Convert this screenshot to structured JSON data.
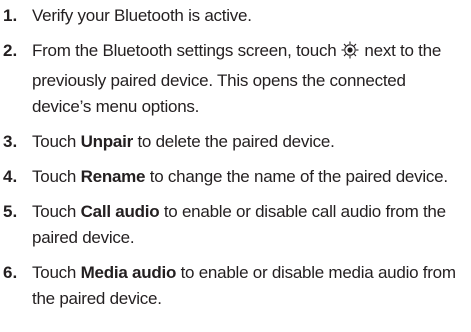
{
  "steps": [
    {
      "number": "1.",
      "text": "Verify your Bluetooth is active."
    },
    {
      "number": "2.",
      "before_icon": "From the Bluetooth settings screen, touch",
      "icon": "settings-gear-icon",
      "after_icon": "next to the previously paired device. This opens the connected device’s menu options."
    },
    {
      "number": "3.",
      "prefix": "Touch",
      "bold": "Unpair",
      "suffix": "to delete the paired device."
    },
    {
      "number": "4.",
      "prefix": "Touch",
      "bold": "Rename",
      "suffix": "to change the name of the paired device."
    },
    {
      "number": "5.",
      "prefix": "Touch",
      "bold": "Call audio",
      "suffix": "to enable or disable call audio from the paired device."
    },
    {
      "number": "6.",
      "prefix": "Touch",
      "bold": "Media audio",
      "suffix": "to enable or disable media audio from the paired device."
    }
  ]
}
